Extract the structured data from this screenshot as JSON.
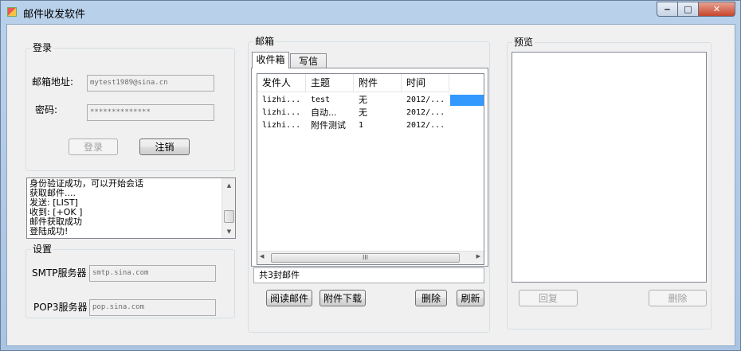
{
  "window": {
    "title": "邮件收发软件",
    "min_glyph": "‒",
    "max_glyph": "□",
    "close_glyph": "✕",
    "icon": "app-icon"
  },
  "login": {
    "group_title": "登录",
    "email_label": "邮箱地址:",
    "email_value": "mytest1989@sina.cn",
    "password_label": "密码:",
    "password_value": "**************",
    "login_button": "登录",
    "logout_button": "注销"
  },
  "log": {
    "lines": [
      "身份验证成功，可以开始会话",
      "获取邮件....",
      "发送: [LIST]",
      "收到: [+OK ]",
      "邮件获取成功",
      "登陆成功!"
    ],
    "up_arrow": "▲",
    "down_arrow": "▼"
  },
  "settings": {
    "group_title": "设置",
    "smtp_label": "SMTP服务器",
    "smtp_value": "smtp.sina.com",
    "pop3_label": "POP3服务器",
    "pop3_value": "pop.sina.com"
  },
  "mailbox": {
    "group_title": "邮箱",
    "tabs": [
      "收件箱",
      "写信"
    ],
    "columns": [
      "发件人",
      "主题",
      "附件",
      "时间"
    ],
    "rows": [
      {
        "sender": "lizhi...",
        "subject": "test",
        "attachment": "无",
        "time": "2012/..."
      },
      {
        "sender": "lizhi...",
        "subject": "自动...",
        "attachment": "无",
        "time": "2012/..."
      },
      {
        "sender": "lizhi...",
        "subject": "附件测试",
        "attachment": "1",
        "time": "2012/..."
      }
    ],
    "hscroll_left": "◀",
    "hscroll_right": "▶",
    "hscroll_grip": "III",
    "status": "共3封邮件",
    "read_button": "阅读邮件",
    "download_button": "附件下载",
    "delete_button": "删除",
    "refresh_button": "刷新"
  },
  "preview": {
    "group_title": "预览",
    "reply_button": "回复",
    "delete_button": "删除"
  },
  "colors": {
    "selection": "#3399ff"
  }
}
